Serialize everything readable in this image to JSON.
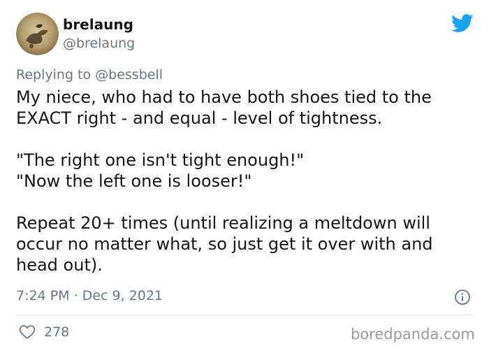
{
  "user": {
    "display_name": "brelaung",
    "handle": "@brelaung"
  },
  "reply": {
    "prefix": "Replying to",
    "mention": "@bessbell"
  },
  "tweet": {
    "lines": [
      "My niece, who had to have both shoes tied to the",
      "EXACT right - and equal - level of tightness.",
      "",
      "\"The right one isn't tight enough!\"",
      "\"Now the left one is looser!\"",
      "",
      "Repeat 20+ times (until realizing a meltdown will",
      "occur no matter what, so just get it over with and",
      "head out)."
    ],
    "timestamp": "7:24 PM · Dec 9, 2021",
    "likes": "278"
  },
  "watermark": "boredpanda.com",
  "colors": {
    "twitter_blue": "#1da1f2",
    "secondary_text": "#657786",
    "primary_text": "#14171a"
  },
  "icons": {
    "brand": "twitter-bird-icon",
    "info": "info-icon",
    "like": "heart-icon"
  }
}
